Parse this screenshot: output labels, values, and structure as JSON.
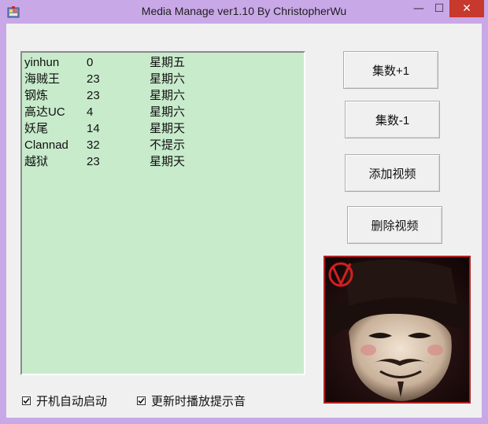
{
  "window": {
    "title": "Media Manage ver1.10 By ChristopherWu",
    "minimize_glyph": "—",
    "maximize_glyph": "☐",
    "close_glyph": "✕"
  },
  "list": {
    "rows": [
      {
        "name": "yinhun",
        "episodes": "0",
        "day": "星期五"
      },
      {
        "name": "海贼王",
        "episodes": "23",
        "day": "星期六"
      },
      {
        "name": "钢炼",
        "episodes": "23",
        "day": "星期六"
      },
      {
        "name": "高达UC",
        "episodes": "4",
        "day": "星期六"
      },
      {
        "name": "妖尾",
        "episodes": "14",
        "day": "星期天"
      },
      {
        "name": "Clannad",
        "episodes": "32",
        "day": "不提示"
      },
      {
        "name": "越狱",
        "episodes": "23",
        "day": "星期天"
      }
    ]
  },
  "buttons": {
    "episode_plus": "集数+1",
    "episode_minus": "集数-1",
    "add_video": "添加视频",
    "delete_video": "删除视频"
  },
  "options": {
    "autostart_label": "开机自动启动",
    "autostart_checked": true,
    "sound_label": "更新时播放提示音",
    "sound_checked": true
  },
  "colors": {
    "titlebar": "#c9a8e8",
    "list_background": "#c8ebcc",
    "close_button": "#c7382d",
    "poster_border": "#b02323"
  },
  "icons": {
    "app": "app-icon",
    "poster": "guy-fawkes-mask-image"
  }
}
